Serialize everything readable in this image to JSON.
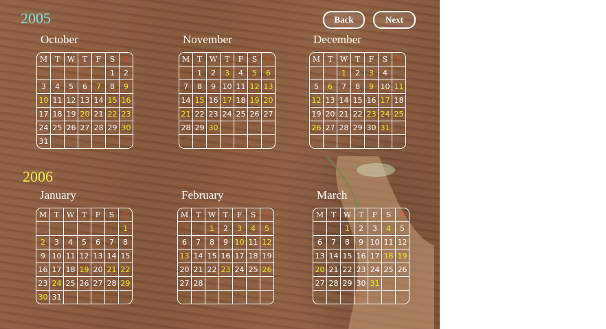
{
  "years": {
    "first": "2005",
    "second": "2006"
  },
  "nav": {
    "back_label": "Back",
    "next_label": "Next"
  },
  "weekday_headers": [
    "M",
    "T",
    "W",
    "T",
    "F",
    "S",
    "S"
  ],
  "months": {
    "october": {
      "title": "October",
      "weeks": [
        [
          "",
          "",
          "",
          "",
          "",
          "1",
          "2"
        ],
        [
          "3",
          "4",
          "5",
          "6",
          "7",
          "8",
          "9"
        ],
        [
          "10",
          "11",
          "12",
          "13",
          "14",
          "15",
          "16"
        ],
        [
          "17",
          "18",
          "19",
          "20",
          "21",
          "22",
          "23"
        ],
        [
          "24",
          "25",
          "26",
          "27",
          "28",
          "29",
          "30"
        ],
        [
          "31",
          "",
          "",
          "",
          "",
          "",
          ""
        ]
      ],
      "highlighted": [
        "7",
        "9",
        "10",
        "15",
        "16",
        "20",
        "22",
        "23",
        "30"
      ]
    },
    "november": {
      "title": "November",
      "weeks": [
        [
          "",
          "1",
          "2",
          "3",
          "4",
          "5",
          "6"
        ],
        [
          "7",
          "8",
          "9",
          "10",
          "11",
          "12",
          "13"
        ],
        [
          "14",
          "15",
          "16",
          "17",
          "18",
          "19",
          "20"
        ],
        [
          "21",
          "22",
          "23",
          "24",
          "25",
          "26",
          "27"
        ],
        [
          "28",
          "29",
          "30",
          "",
          "",
          "",
          ""
        ],
        [
          "",
          "",
          "",
          "",
          "",
          "",
          ""
        ]
      ],
      "highlighted": [
        "3",
        "5",
        "6",
        "12",
        "13",
        "15",
        "17",
        "19",
        "20",
        "21",
        "30"
      ]
    },
    "december": {
      "title": "December",
      "weeks": [
        [
          "",
          "",
          "1",
          "2",
          "3",
          "4"
        ],
        [
          "5",
          "6",
          "7",
          "8",
          "9",
          "10",
          "11"
        ],
        [
          "12",
          "13",
          "14",
          "15",
          "16",
          "17",
          "18"
        ],
        [
          "19",
          "20",
          "21",
          "22",
          "23",
          "24",
          "25"
        ],
        [
          "26",
          "27",
          "28",
          "29",
          "30",
          "31",
          ""
        ],
        [
          "",
          "",
          "",
          "",
          "",
          "",
          ""
        ]
      ],
      "highlighted": [
        "1",
        "3",
        "6",
        "9",
        "11",
        "12",
        "17",
        "23",
        "24",
        "25",
        "26",
        "31"
      ]
    },
    "january": {
      "title": "January",
      "weeks": [
        [
          "",
          "",
          "",
          "",
          "",
          "",
          "1"
        ],
        [
          "2",
          "3",
          "4",
          "5",
          "6",
          "7",
          "8"
        ],
        [
          "9",
          "10",
          "11",
          "12",
          "13",
          "14",
          "15"
        ],
        [
          "16",
          "17",
          "18",
          "19",
          "20",
          "21",
          "22"
        ],
        [
          "23",
          "24",
          "25",
          "26",
          "27",
          "28",
          "29"
        ],
        [
          "30",
          "31",
          "",
          "",
          "",
          "",
          ""
        ]
      ],
      "highlighted": [
        "1",
        "2",
        "19",
        "21",
        "22",
        "24",
        "29",
        "30"
      ]
    },
    "february": {
      "title": "February",
      "weeks": [
        [
          "",
          "",
          "1",
          "2",
          "3",
          "4",
          "5"
        ],
        [
          "6",
          "7",
          "8",
          "9",
          "10",
          "11",
          "12"
        ],
        [
          "13",
          "14",
          "15",
          "16",
          "17",
          "18",
          "19"
        ],
        [
          "20",
          "21",
          "22",
          "23",
          "24",
          "25",
          "26"
        ],
        [
          "27",
          "28",
          "",
          "",
          "",
          "",
          ""
        ],
        [
          "",
          "",
          "",
          "",
          "",
          "",
          ""
        ]
      ],
      "highlighted": [
        "1",
        "3",
        "4",
        "5",
        "10",
        "12",
        "13",
        "23",
        "26"
      ]
    },
    "march": {
      "title": "March",
      "weeks": [
        [
          "",
          "",
          "1",
          "2",
          "3",
          "4",
          "5"
        ],
        [
          "6",
          "7",
          "8",
          "9",
          "10",
          "11",
          "12"
        ],
        [
          "13",
          "14",
          "15",
          "16",
          "17",
          "18",
          "19"
        ],
        [
          "20",
          "21",
          "22",
          "23",
          "24",
          "25",
          "26"
        ],
        [
          "27",
          "28",
          "29",
          "30",
          "31",
          "",
          ""
        ],
        [
          "",
          "",
          "",
          "",
          "",
          "",
          ""
        ]
      ],
      "highlighted": [
        "1",
        "4",
        "18",
        "19",
        "20",
        "31"
      ]
    }
  },
  "colors": {
    "year_2005": "#7fe3e3",
    "year_2006": "#f4f04a",
    "highlight": "#f0ec28",
    "sunday_header": "#e04a20",
    "grid": "#ffffff"
  }
}
